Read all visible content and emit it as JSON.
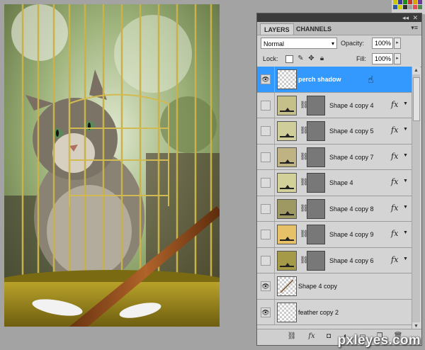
{
  "panel": {
    "tabs": [
      "LAYERS",
      "CHANNELS"
    ],
    "blend_mode": "Normal",
    "opacity_label": "Opacity:",
    "opacity_value": "100%",
    "lock_label": "Lock:",
    "fill_label": "Fill:",
    "fill_value": "100%"
  },
  "layers": [
    {
      "name": "perch shadow",
      "visible": true,
      "selected": true,
      "type": "raster"
    },
    {
      "name": "Shape 4 copy 4",
      "visible": false,
      "type": "shape",
      "swatch": "#c5c08a"
    },
    {
      "name": "Shape 4 copy 5",
      "visible": false,
      "type": "shape",
      "swatch": "#cfcd9a"
    },
    {
      "name": "Shape 4 copy 7",
      "visible": false,
      "type": "shape",
      "swatch": "#bfb283"
    },
    {
      "name": "Shape 4",
      "visible": false,
      "type": "shape",
      "swatch": "#d3d19a"
    },
    {
      "name": "Shape 4 copy 8",
      "visible": false,
      "type": "shape",
      "swatch": "#9e9863"
    },
    {
      "name": "Shape 4 copy 9",
      "visible": false,
      "type": "shape",
      "swatch": "#e7c168"
    },
    {
      "name": "Shape 4 copy 6",
      "visible": false,
      "type": "shape",
      "swatch": "#a59a48"
    },
    {
      "name": "Shape 4 copy",
      "visible": true,
      "type": "raster"
    },
    {
      "name": "feather copy 2",
      "visible": true,
      "type": "raster"
    }
  ],
  "watermark": "pxleyes.com"
}
